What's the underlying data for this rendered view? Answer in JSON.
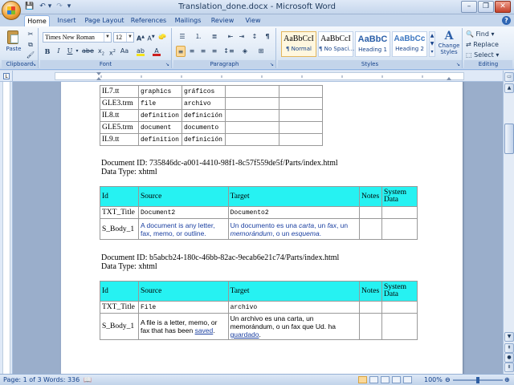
{
  "window": {
    "title": "Translation_done.docx - Microsoft Word"
  },
  "tabs": [
    "Home",
    "Insert",
    "Page Layout",
    "References",
    "Mailings",
    "Review",
    "View"
  ],
  "ribbon": {
    "clipboard": {
      "label": "Clipboard",
      "paste": "Paste"
    },
    "font": {
      "label": "Font",
      "name": "Times New Roman",
      "size": "12",
      "font_color": "#cc1f1f",
      "highlight_color": "#f5e31a"
    },
    "paragraph": {
      "label": "Paragraph"
    },
    "styles": {
      "label": "Styles",
      "items": [
        {
          "sample": "AaBbCcI",
          "name": "¶ Normal",
          "selected": true
        },
        {
          "sample": "AaBbCcI",
          "name": "¶ No Spaci...",
          "selected": false
        },
        {
          "sample": "AaBbC",
          "name": "Heading 1",
          "selected": false
        },
        {
          "sample": "AaBbCc",
          "name": "Heading 2",
          "selected": false
        }
      ],
      "change_styles": "Change Styles"
    },
    "editing": {
      "label": "Editing",
      "find": "Find",
      "replace": "Replace",
      "select": "Select"
    }
  },
  "document": {
    "top_table": {
      "rows": [
        [
          "IL7.tt",
          "graphics",
          "gráficos",
          "",
          ""
        ],
        [
          "GLE3.trm",
          "file",
          "archivo",
          "",
          ""
        ],
        [
          "IL8.tt",
          "definition",
          "definición",
          "",
          ""
        ],
        [
          "GLE5.trm",
          "document",
          "documento",
          "",
          ""
        ],
        [
          "IL9.tt",
          "definition",
          "definición",
          "",
          ""
        ]
      ]
    },
    "section1": {
      "doc_id": "Document ID: 735846dc-a001-4410-98f1-8c57f559de5f/Parts/index.html",
      "data_type": "Data Type: xhtml",
      "headers": [
        "Id",
        "Source",
        "Target",
        "Notes",
        "System Data"
      ],
      "title_row": {
        "id": "TXT_Title",
        "source": "Document2",
        "target": "Documento2"
      },
      "body_row": {
        "id": "S_Body_1",
        "source": "A document is any letter, fax, memo, or outline.",
        "target_parts": [
          "Un documento es una ",
          "carta",
          ", un ",
          "fax",
          ", un ",
          "memorándum",
          ", o un ",
          "esquema",
          "."
        ]
      }
    },
    "section2": {
      "doc_id": "Document ID: b5abcb24-180c-46bb-82ac-9ecab6e21c74/Parts/index.html",
      "data_type": "Data Type: xhtml",
      "headers": [
        "Id",
        "Source",
        "Target",
        "Notes",
        "System Data"
      ],
      "title_row": {
        "id": "TXT_Title",
        "source": "File",
        "target": "archivo"
      },
      "body_row": {
        "id": "S_Body_1",
        "source_text": "A file is a letter, memo, or fax that has been ",
        "source_link": "saved",
        "source_end": ".",
        "target_text": "Un archivo es una carta, un memorándum, o un fax que Ud. ha ",
        "target_link": "guardado",
        "target_end": "."
      }
    }
  },
  "status": {
    "page": "Page: 1 of 3",
    "words": "Words: 336",
    "zoom": "100%",
    "zoom_level": 0.5
  }
}
